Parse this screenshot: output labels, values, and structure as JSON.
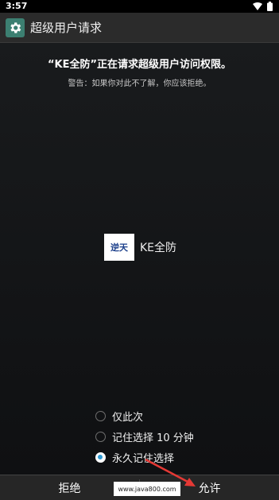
{
  "status_bar": {
    "time": "3:57"
  },
  "action_bar": {
    "title": "超级用户请求",
    "icon": "gear-icon",
    "icon_bg": "#3c7f71"
  },
  "request": {
    "headline": "“KE全防”正在请求超级用户访问权限。",
    "warning": "警告：如果你对此不了解，你应该拒绝。"
  },
  "app": {
    "badge_text": "逆天",
    "name": "KE全防"
  },
  "options": [
    {
      "label": "仅此次",
      "checked": false
    },
    {
      "label": "记住选择 10 分钟",
      "checked": false
    },
    {
      "label": "永久记住选择",
      "checked": true
    }
  ],
  "buttons": {
    "deny": "拒绝",
    "allow": "允许"
  },
  "watermark": "www.java800.com",
  "colors": {
    "accent": "#2e9ad3",
    "annotation_arrow": "#e53935"
  }
}
